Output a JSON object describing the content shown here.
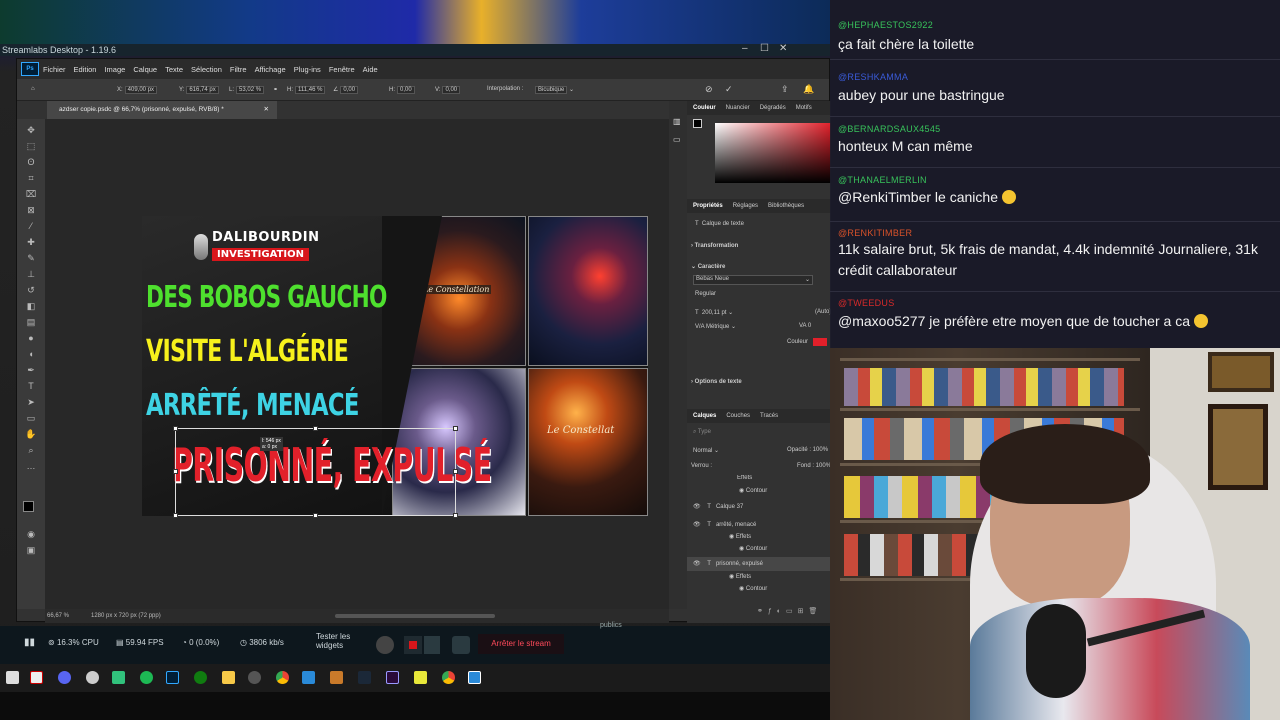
{
  "streamlabs": {
    "title": "Streamlabs Desktop - 1.19.6",
    "cpu": "16.3% CPU",
    "fps": "59.94 FPS",
    "dropped": "0 (0.0%)",
    "bitrate": "3806 kb/s",
    "test_widgets_1": "Tester les",
    "test_widgets_2": "widgets",
    "stop_stream": "Arrêter le stream",
    "publics": "publics"
  },
  "photoshop": {
    "menu": [
      "Fichier",
      "Edition",
      "Image",
      "Calque",
      "Texte",
      "Sélection",
      "Filtre",
      "Affichage",
      "Plug-ins",
      "Fenêtre",
      "Aide"
    ],
    "options": {
      "x": "409,00 px",
      "y": "616,74 px",
      "l": "53,02 %",
      "h": "111,46 %",
      "angle": "0,00",
      "h2": "0,00",
      "v": "0,00",
      "interp_label": "Interpolation :",
      "interp_value": "Bicubique"
    },
    "doc_tab": "azdser copie.psdc @ 66,7% (prisonné, expulsé, RVB/8) *",
    "status_zoom": "66,67 %",
    "status_size": "1280 px x 720 px (72 ppp)",
    "transform_readout_1": "l: 546 px",
    "transform_readout_2": "a: 0 px",
    "panels": {
      "color_tabs": [
        "Couleur",
        "Nuancier",
        "Dégradés",
        "Motifs"
      ],
      "prop_tabs": [
        "Propriétés",
        "Réglages",
        "Bibliothèques"
      ],
      "text_layer": "Calque de texte",
      "transformation": "Transformation",
      "character": "Caractère",
      "font": "Bebas Neue",
      "style": "Regular",
      "size": "200,11 pt",
      "auto": "(Auto)",
      "metric": "Métrique",
      "tracking": "0",
      "color_label": "Couleur",
      "text_options": "Options de texte",
      "layers_tabs": [
        "Calques",
        "Couches",
        "Tracés"
      ],
      "search": "Type",
      "blend": "Normal",
      "opacity": "Opacité : 100%",
      "lock": "Verrou :",
      "fill": "Fond : 100%",
      "layers": [
        {
          "name": "Effets",
          "indent": 2
        },
        {
          "name": "Contour",
          "indent": 3
        },
        {
          "name": "Calque 37",
          "indent": 1
        },
        {
          "name": "arrêté, menacé",
          "indent": 1
        },
        {
          "name": "Effets",
          "indent": 2
        },
        {
          "name": "Contour",
          "indent": 3
        },
        {
          "name": "prisonné, expulsé",
          "indent": 1
        },
        {
          "name": "Effets",
          "indent": 2
        },
        {
          "name": "Contour",
          "indent": 3
        }
      ]
    }
  },
  "thumbnail": {
    "brand_top": "DALIBOURDIN",
    "brand_bottom": "INVESTIGATION",
    "line1": "DES BOBOS GAUCHO",
    "line2": "VISITE L'ALGÉRIE",
    "line3": "ARRÊTÉ, MENACÉ",
    "line4": "PRISONNÉ, EXPULSÉ",
    "sign1": "Le Constellation",
    "sign2": "Le Constellat"
  },
  "chat": [
    {
      "user": "@HEPHAESTOS2922",
      "text": "ça fait chère la toilette",
      "color": "#38c35b"
    },
    {
      "user": "@RESHKAMMA",
      "text": "aubey pour une bastringue",
      "color": "#3a5bd8"
    },
    {
      "user": "@BERNARDSAUX4545",
      "text": "honteux M can même",
      "color": "#38c35b"
    },
    {
      "user": "@THANAELMERLIN",
      "text": "@RenkiTimber le caniche",
      "color": "#38c35b"
    },
    {
      "user": "@RENKITIMBER",
      "text": "11k salaire brut, 5k frais de mandat, 4.4k indemnité Journaliere, 31k crédit callaborateur",
      "color": "#d8522a"
    },
    {
      "user": "@TWEEDUS",
      "text": "@maxoo5277 je préfère etre moyen que de toucher a ca",
      "color": "#d82a2a"
    }
  ]
}
